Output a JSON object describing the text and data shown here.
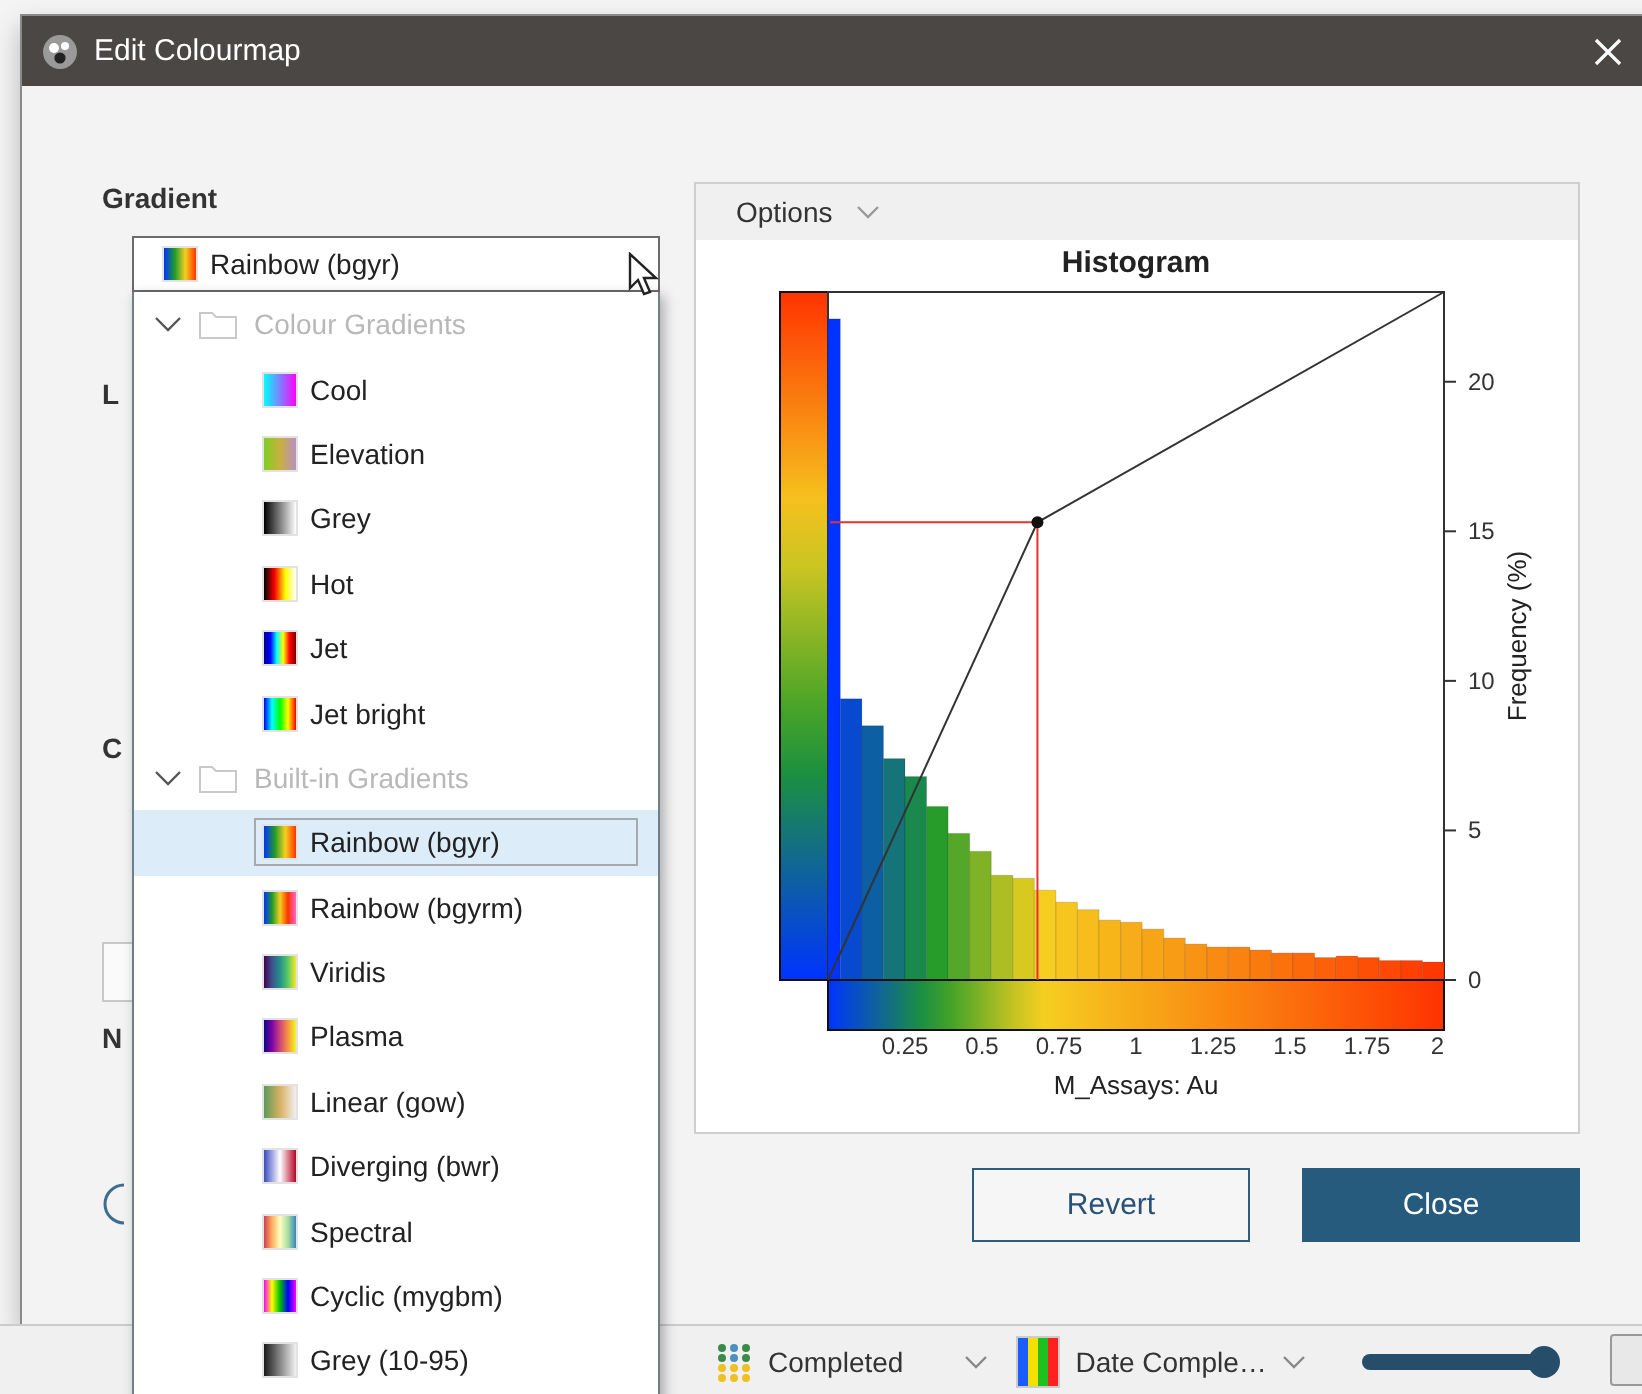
{
  "window": {
    "title": "Edit Colourmap"
  },
  "form": {
    "gradient_label": "Gradient",
    "partly_hidden_labels": [
      "L",
      "C",
      "N"
    ]
  },
  "gradient_picker": {
    "value": "Rainbow (bgyr)",
    "groups": [
      {
        "label": "Colour Gradients",
        "expanded": true,
        "disabled": true,
        "children": [
          {
            "label": "Cool",
            "selected": false
          },
          {
            "label": "Elevation",
            "selected": false
          },
          {
            "label": "Grey",
            "selected": false
          },
          {
            "label": "Hot",
            "selected": false
          },
          {
            "label": "Jet",
            "selected": false
          },
          {
            "label": "Jet bright",
            "selected": false
          }
        ]
      },
      {
        "label": "Built-in Gradients",
        "expanded": true,
        "disabled": true,
        "children": [
          {
            "label": "Rainbow (bgyr)",
            "selected": true
          },
          {
            "label": "Rainbow (bgyrm)",
            "selected": false
          },
          {
            "label": "Viridis",
            "selected": false
          },
          {
            "label": "Plasma",
            "selected": false
          },
          {
            "label": "Linear (gow)",
            "selected": false
          },
          {
            "label": "Diverging (bwr)",
            "selected": false
          },
          {
            "label": "Spectral",
            "selected": false
          },
          {
            "label": "Cyclic (mygbm)",
            "selected": false
          },
          {
            "label": "Grey (10-95)",
            "selected": false
          }
        ]
      }
    ]
  },
  "histogram_panel": {
    "options_label": "Options",
    "chart_data": {
      "type": "bar",
      "title": "Histogram",
      "xlabel": "M_Assays: Au",
      "ylabel": "Frequency (%)",
      "x": [
        0.02,
        0.075,
        0.145,
        0.215,
        0.285,
        0.355,
        0.425,
        0.495,
        0.565,
        0.635,
        0.705,
        0.775,
        0.845,
        0.915,
        0.985,
        1.055,
        1.125,
        1.195,
        1.265,
        1.335,
        1.405,
        1.475,
        1.545,
        1.615,
        1.685,
        1.755,
        1.825,
        1.895,
        1.965
      ],
      "values": [
        22.1,
        9.4,
        8.5,
        7.4,
        6.8,
        5.8,
        4.9,
        4.3,
        3.5,
        3.4,
        3.0,
        2.6,
        2.35,
        2.0,
        1.93,
        1.7,
        1.4,
        1.2,
        1.1,
        1.1,
        1.0,
        0.9,
        0.9,
        0.75,
        0.8,
        0.75,
        0.65,
        0.65,
        0.6
      ],
      "xlim": [
        0,
        2
      ],
      "ylim": [
        0,
        23
      ],
      "xticks": [
        0.25,
        0.5,
        0.75,
        1,
        1.25,
        1.5,
        1.75,
        2
      ],
      "yticks": [
        0,
        5,
        10,
        15,
        20
      ]
    }
  },
  "buttons": [
    {
      "label": "Revert",
      "kind": "secondary"
    },
    {
      "label": "Close",
      "kind": "primary"
    }
  ],
  "status_bar": {
    "colour_by": "Completed",
    "legend": "Date Comple…",
    "slider": {
      "level": 0.94
    }
  }
}
